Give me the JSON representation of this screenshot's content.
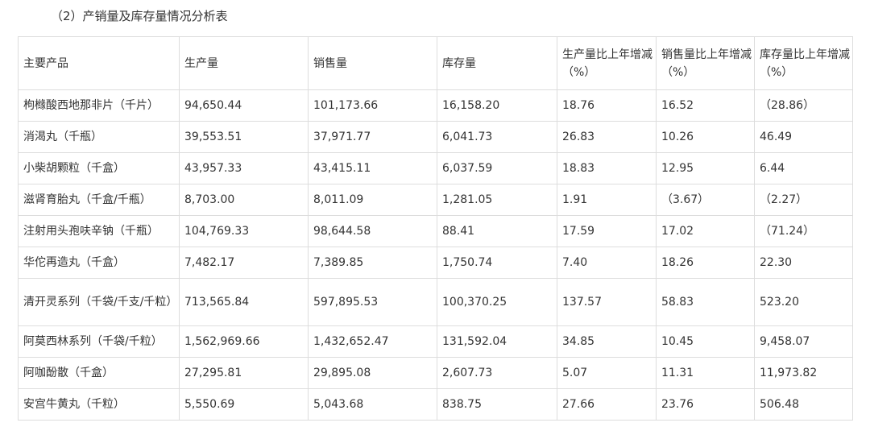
{
  "title": "（2）产销量及库存量情况分析表",
  "table": {
    "headers": [
      "主要产品",
      "生产量",
      "销售量",
      "库存量",
      "生产量比上年增减（%）",
      "销售量比上年增减（%）",
      "库存量比上年增减（%）"
    ],
    "rows": [
      [
        "枸橼酸西地那非片（千片）",
        "94,650.44",
        "101,173.66",
        "16,158.20",
        "18.76",
        "16.52",
        "（28.86）"
      ],
      [
        "消渴丸（千瓶）",
        "39,553.51",
        "37,971.77",
        "6,041.73",
        "26.83",
        "10.26",
        "46.49"
      ],
      [
        "小柴胡颗粒（千盒）",
        "43,957.33",
        "43,415.11",
        "6,037.59",
        "18.83",
        "12.95",
        "6.44"
      ],
      [
        "滋肾育胎丸（千盒/千瓶）",
        "8,703.00",
        "8,011.09",
        "1,281.05",
        "1.91",
        "（3.67）",
        "（2.27）"
      ],
      [
        "注射用头孢呋辛钠（千瓶）",
        "104,769.33",
        "98,644.58",
        "88.41",
        "17.59",
        "17.02",
        "（71.24）"
      ],
      [
        "华佗再造丸（千盒）",
        "7,482.17",
        "7,389.85",
        "1,750.74",
        "7.40",
        "18.26",
        "22.30"
      ],
      [
        "清开灵系列（千袋/千支/千粒）",
        "713,565.84",
        "597,895.53",
        "100,370.25",
        "137.57",
        "58.83",
        "523.20"
      ],
      [
        "阿莫西林系列（千袋/千粒）",
        "1,562,969.66",
        "1,432,652.47",
        "131,592.04",
        "34.85",
        "10.45",
        "9,458.07"
      ],
      [
        "阿咖酚散（千盒）",
        "27,295.81",
        "29,895.08",
        "2,607.73",
        "5.07",
        "11.31",
        "11,973.82"
      ],
      [
        "安宫牛黄丸（千粒）",
        "5,550.69",
        "5,043.68",
        "838.75",
        "27.66",
        "23.76",
        "506.48"
      ]
    ]
  }
}
